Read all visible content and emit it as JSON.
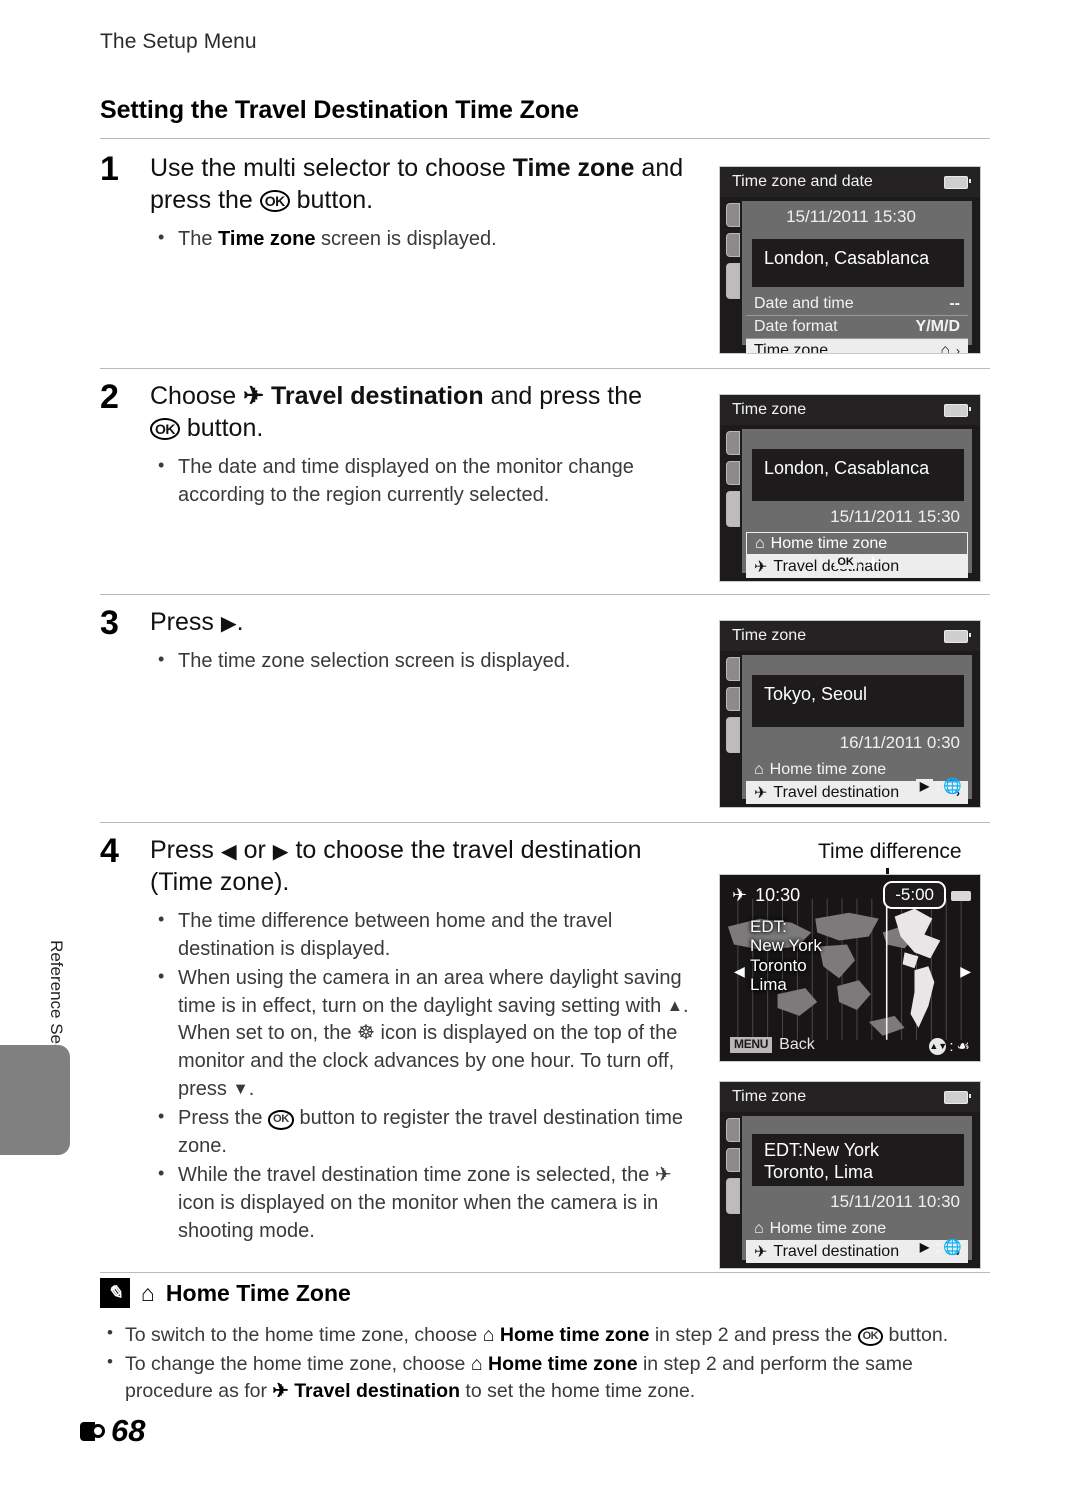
{
  "running_head": "The Setup Menu",
  "section_title": "Setting the Travel Destination Time Zone",
  "side_tab": {
    "label": "Reference Section"
  },
  "folio": {
    "page": "68"
  },
  "steps": [
    {
      "number": "1",
      "head_pre": "Use the multi selector to choose ",
      "head_bold": "Time zone",
      "head_mid": " and press the ",
      "head_post": " button.",
      "bullets": [
        {
          "pre": "The ",
          "bold": "Time zone",
          "post": " screen is displayed."
        }
      ]
    },
    {
      "number": "2",
      "head_pre": "Choose ",
      "head_bold": "Travel destination",
      "head_mid": " and press the ",
      "head_post": " button.",
      "bullets": [
        {
          "pre": "The date and time displayed on the monitor change according to the region currently selected.",
          "bold": "",
          "post": ""
        }
      ]
    },
    {
      "number": "3",
      "head_pre": "Press ",
      "head_bold": "",
      "head_mid": "",
      "head_post": ".",
      "bullets": [
        {
          "pre": "The time zone selection screen is displayed.",
          "bold": "",
          "post": ""
        }
      ]
    },
    {
      "number": "4",
      "head_pre": "Press ",
      "head_or": " or ",
      "head_post": " to choose the travel destination (Time zone).",
      "bullets": [
        {
          "text": "The time difference between home and the travel destination is displayed."
        },
        {
          "text_a": "When using the camera in an area where daylight saving time is in effect, turn on the daylight saving setting with ",
          "text_b": ". When set to on, the ",
          "text_c": " icon is displayed on the top of the monitor and the clock advances by one hour. To turn off, press ",
          "text_d": "."
        },
        {
          "text_a": "Press the ",
          "text_b": " button to register the travel destination time zone."
        },
        {
          "text_a": "While the travel destination time zone is selected, the ",
          "text_b": " icon is displayed on the monitor when the camera is in shooting mode."
        }
      ]
    }
  ],
  "callout": {
    "time_difference_label": "Time difference"
  },
  "screens": [
    {
      "id": "screen-1",
      "title": "Time zone and date",
      "datetime": "15/11/2011  15:30",
      "city": "London, Casablanca",
      "rows": [
        {
          "label": "Date and time",
          "value": "--",
          "state": "dim"
        },
        {
          "label": "Date format",
          "value": "Y/M/D",
          "state": "dim"
        },
        {
          "label": "Time zone",
          "value": "",
          "state": "hl",
          "icon": "home-icon",
          "chevron": "›"
        }
      ]
    },
    {
      "id": "screen-2",
      "title": "Time zone",
      "city": "London, Casablanca",
      "datetime": "15/11/2011  15:30",
      "rows": [
        {
          "label": "Home time zone",
          "state": "outline",
          "icon": "home-icon"
        },
        {
          "label": "Travel destination",
          "state": "hl",
          "icon": "plane-icon"
        }
      ],
      "footer": {
        "ok": "OK",
        "sep": ":",
        "icon": "plane-icon"
      }
    },
    {
      "id": "screen-3",
      "title": "Time zone",
      "city": "Tokyo, Seoul",
      "datetime": "16/11/2011  0:30",
      "rows": [
        {
          "label": "Home time zone",
          "state": "plain",
          "icon": "home-icon"
        },
        {
          "label": "Travel destination",
          "state": "hl",
          "icon": "plane-icon",
          "chevron": "›"
        }
      ],
      "footer": {
        "ok": "▶",
        "sep": ":",
        "icon": "globe-icon"
      }
    },
    {
      "id": "screen-4-map",
      "time": "10:30",
      "time_diff": "-5:00",
      "cities": [
        "EDT:",
        "New York",
        "Toronto",
        "Lima"
      ],
      "menu_chip": "MENU",
      "back_label": "Back",
      "footer_icon": "daylight-saving-icon"
    },
    {
      "id": "screen-5",
      "title": "Time zone",
      "city_line1": "EDT:New York",
      "city_line2": "Toronto, Lima",
      "datetime": "15/11/2011  10:30",
      "rows": [
        {
          "label": "Home time zone",
          "state": "plain",
          "icon": "home-icon"
        },
        {
          "label": "Travel destination",
          "state": "hl",
          "icon": "plane-icon",
          "chevron": "›"
        }
      ],
      "footer": {
        "ok": "▶",
        "sep": ":",
        "icon": "globe-icon"
      }
    }
  ],
  "note": {
    "title": "Home Time Zone",
    "title_icon": "home-icon",
    "bullets": [
      {
        "a": "To switch to the home time zone, choose ",
        "b": "Home time zone",
        "c": " in step 2 and press the ",
        "d": " button."
      },
      {
        "a": "To change the home time zone, choose ",
        "b": "Home time zone",
        "c": " in step 2 and perform the same procedure as for ",
        "d2": "Travel destination",
        "e": " to set the home time zone."
      }
    ]
  },
  "glyphs": {
    "ok": "OK",
    "plane": "✈",
    "home": "⌂",
    "left_tri": "◀",
    "right_tri": "▶",
    "up_tri": "▲",
    "down_tri": "▼",
    "dst": "☸"
  },
  "colors": {
    "rule": "#b9b9b9",
    "tab_gray": "#808080",
    "screen_bg": "#1c1a1a",
    "panel_gray": "#6d6c6c",
    "highlight": "#ededed"
  }
}
